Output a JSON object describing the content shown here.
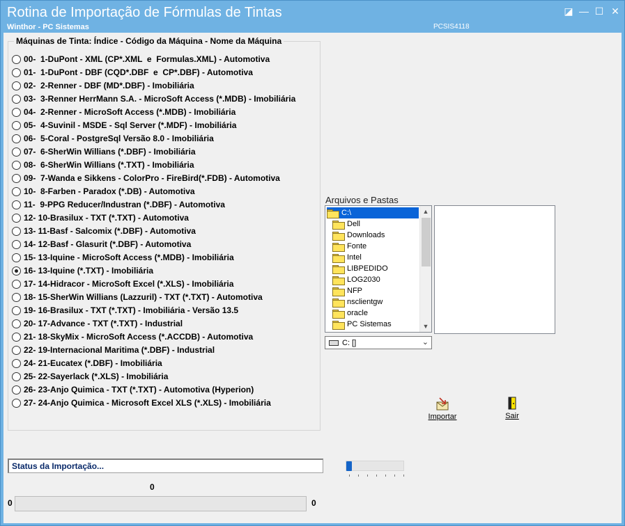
{
  "window": {
    "title": "Rotina de Importação de Fórmulas de Tintas",
    "subtitle": "Winthor - PC Sistemas",
    "code": "PCSIS4118",
    "controls": {
      "restore": "◪",
      "minimize": "—",
      "maximize": "☐",
      "close": "✕"
    }
  },
  "machines": {
    "group_title": "Máquinas de Tinta: Índice - Código da Máquina - Nome da Máquina",
    "selected_index": 16,
    "items": [
      "00-  1-DuPont - XML (CP*.XML  e  Formulas.XML) - Automotiva",
      "01-  1-DuPont - DBF (CQD*.DBF  e  CP*.DBF) - Automotiva",
      "02-  2-Renner - DBF (MD*.DBF) - Imobiliária",
      "03-  3-Renner HerrMann S.A. - MicroSoft Access (*.MDB) - Imobiliária",
      "04-  2-Renner - MicroSoft Access (*.MDB) - Imobiliária",
      "05-  4-Suvinil - MSDE - Sql Server (*.MDF) - Imobiliária",
      "06-  5-Coral - PostgreSql Versão 8.0 - Imobiliária",
      "07-  6-SherWin Willians (*.DBF) - Imobiliária",
      "08-  6-SherWin Willians (*.TXT) - Imobiliária",
      "09-  7-Wanda e Sikkens - ColorPro - FireBird(*.FDB) - Automotiva",
      "10-  8-Farben - Paradox (*.DB) - Automotiva",
      "11-  9-PPG Reducer/Industran (*.DBF) - Automotiva",
      "12- 10-Brasilux - TXT (*.TXT) - Automotiva",
      "13- 11-Basf - Salcomix (*.DBF) - Automotiva",
      "14- 12-Basf - Glasurit (*.DBF) - Automotiva",
      "15- 13-Iquine - MicroSoft Access (*.MDB) - Imobiliária",
      "16- 13-Iquine (*.TXT) - Imobiliária",
      "17- 14-Hidracor - MicroSoft Excel (*.XLS) - Imobiliária",
      "18- 15-SherWin Willians (Lazzuril) - TXT (*.TXT) - Automotiva",
      "19- 16-Brasilux - TXT (*.TXT) - Imobiliária - Versão 13.5",
      "20- 17-Advance - TXT (*.TXT) - Industrial",
      "21- 18-SkyMix - MicroSoft Access (*.ACCDB) - Automotiva",
      "22- 19-Internacional Maritima (*.DBF) - Industrial",
      "24- 21-Eucatex (*.DBF) - Imobiliária",
      "25- 22-Sayerlack (*.XLS) - Imobiliária",
      "26- 23-Anjo Quimica - TXT (*.TXT) - Automotiva (Hyperion)",
      "27- 24-Anjo Quimica - Microsoft Excel XLS (*.XLS) - Imobiliária"
    ]
  },
  "files": {
    "label": "Arquivos e Pastas",
    "root": "C:\\",
    "folders": [
      "Dell",
      "Downloads",
      "Fonte",
      "Intel",
      "LIBPEDIDO",
      "LOG2030",
      "NFP",
      "nsclientgw",
      "oracle",
      "PC Sistemas"
    ],
    "drive": "C: []"
  },
  "buttons": {
    "import": "Importar",
    "exit": "Sair"
  },
  "status": {
    "text": "Status da Importação...",
    "count_top": "0",
    "count_left": "0",
    "count_right": "0",
    "progress": 0,
    "slider_position": 0
  },
  "colors": {
    "title_bar": "#6fb2e3",
    "selection": "#0a64d8",
    "status_text": "#0a2a6a"
  }
}
